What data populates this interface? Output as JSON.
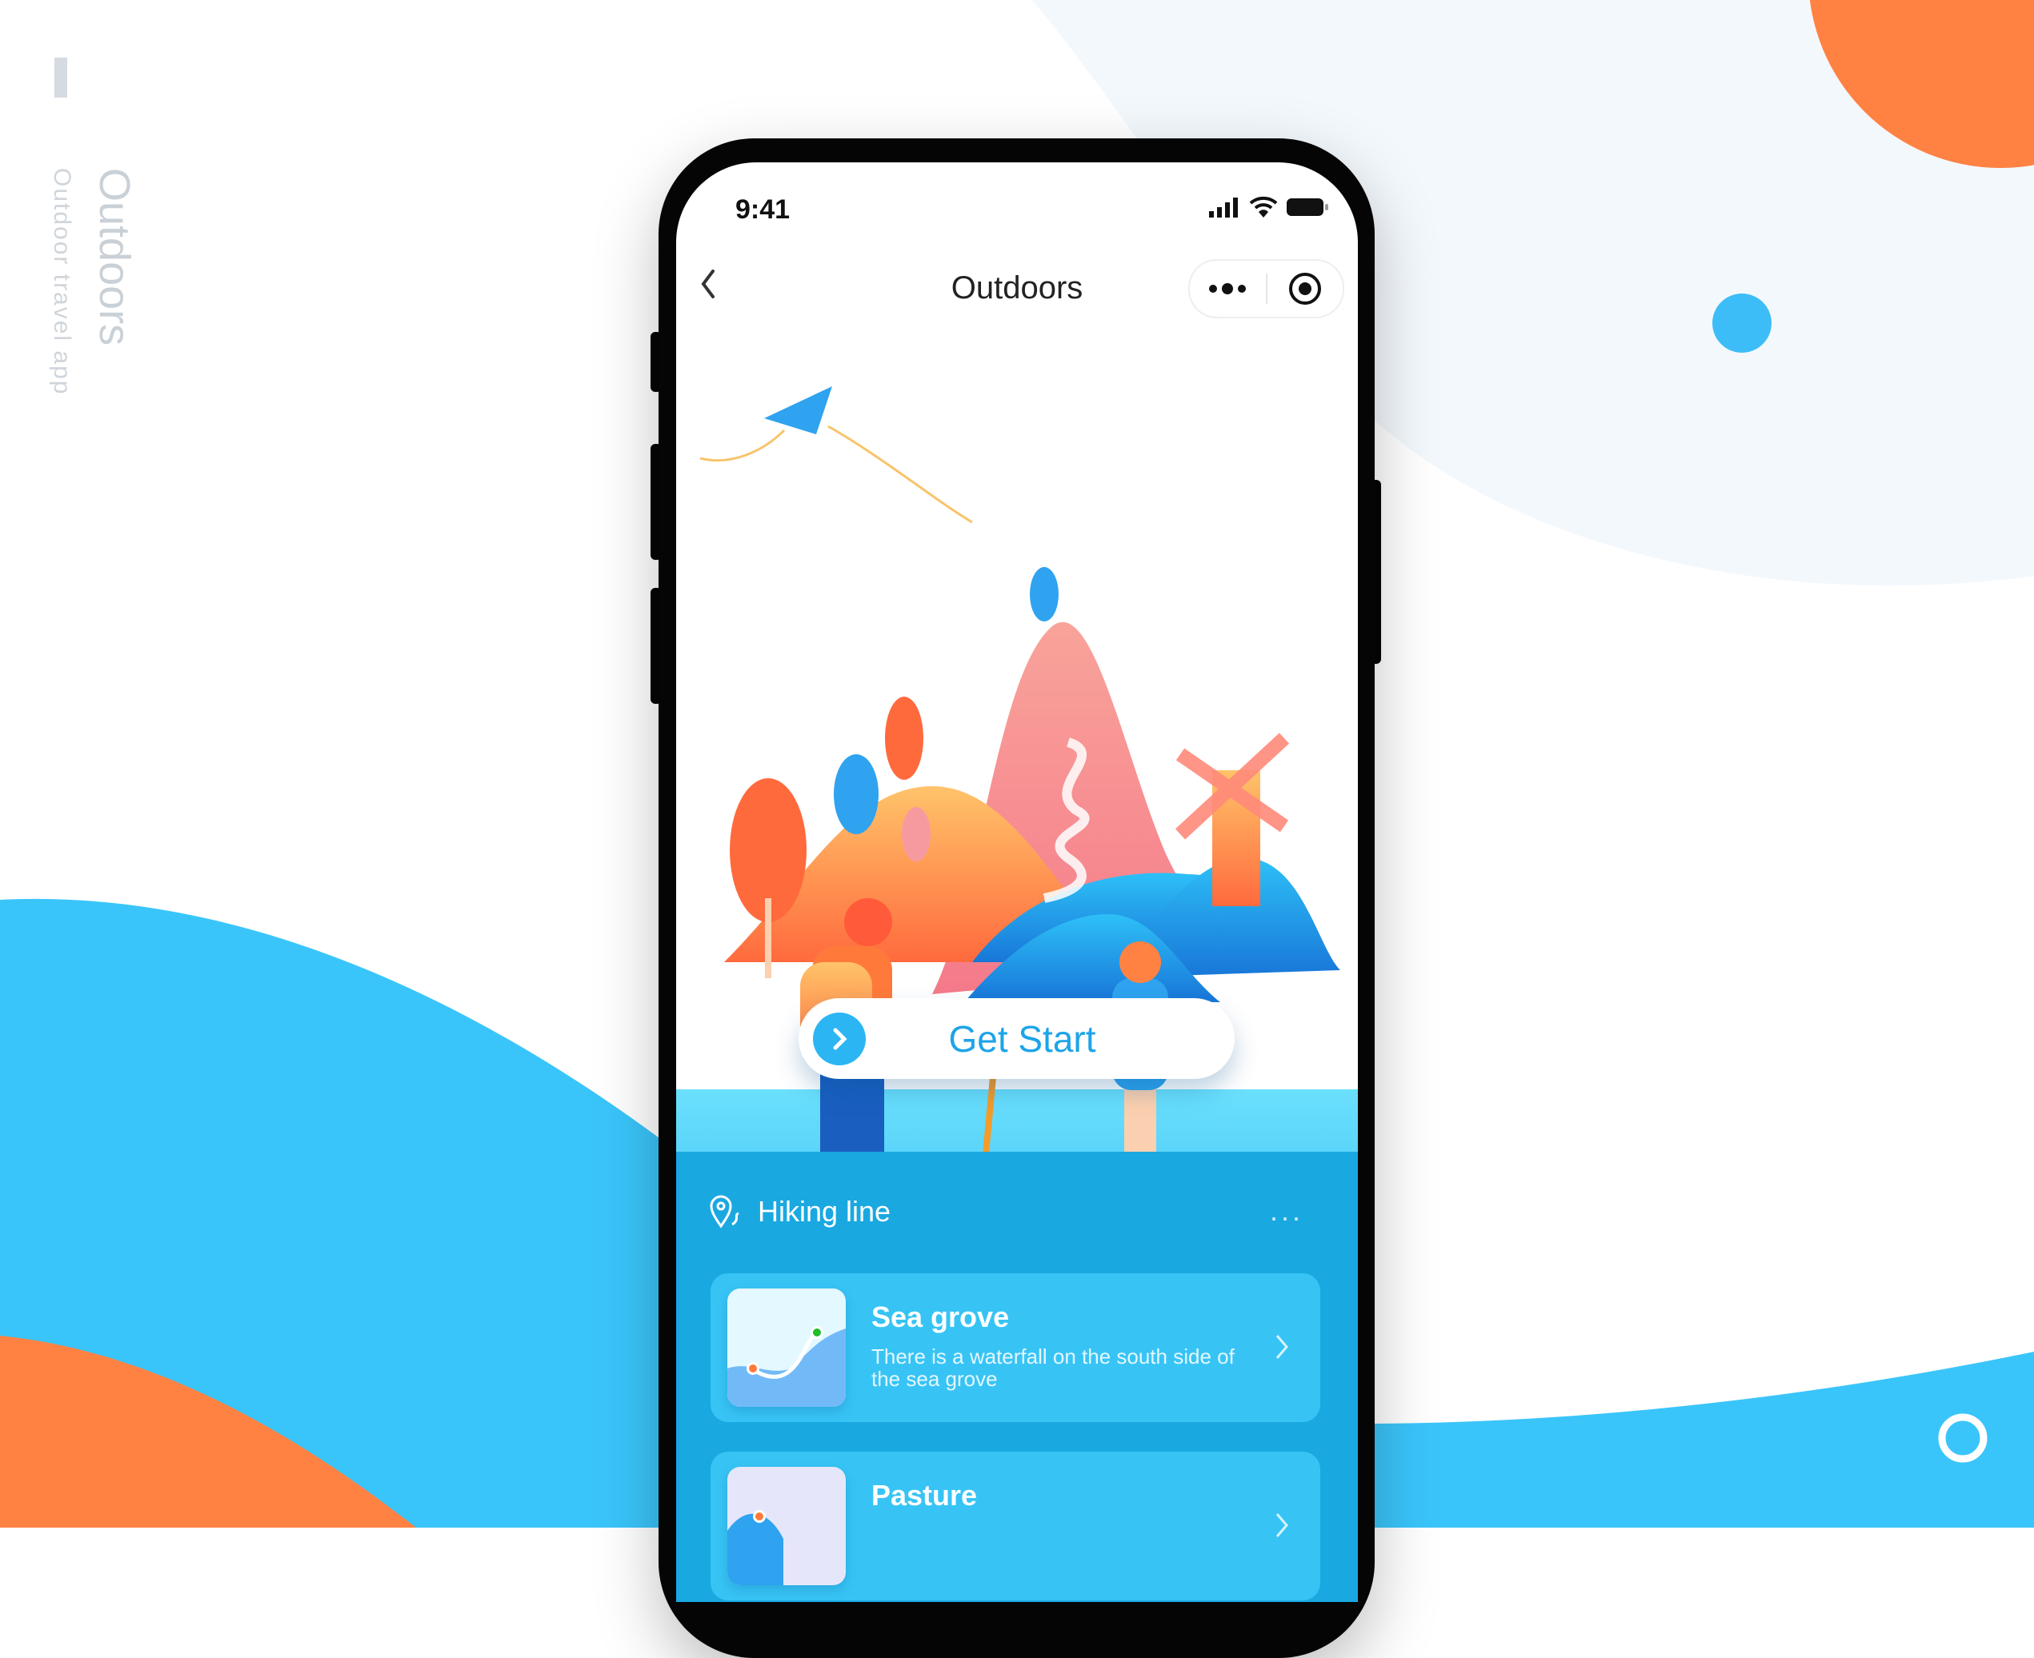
{
  "side": {
    "title": "Outdoors",
    "subtitle": "Outdoor travel app"
  },
  "status_bar": {
    "time": "9:41",
    "icons": [
      "signal-icon",
      "wifi-icon",
      "battery-icon"
    ]
  },
  "nav": {
    "title": "Outdoors",
    "back_icon": "chevron-left-icon",
    "more_icon": "more-dots-icon",
    "close_icon": "target-circle-icon"
  },
  "cta": {
    "label": "Get Start",
    "icon": "chevron-right-icon"
  },
  "hiking": {
    "title": "Hiking line",
    "more": "...",
    "items": [
      {
        "title": "Sea grove",
        "description": "There is a waterfall on the south side of the sea grove"
      },
      {
        "title": "Pasture",
        "description": ""
      }
    ]
  },
  "colors": {
    "accent_blue": "#3ac5fa",
    "deep_blue": "#1aa8e0",
    "orange": "#ff8243",
    "light_blue_dot": "#3dbdf7"
  }
}
